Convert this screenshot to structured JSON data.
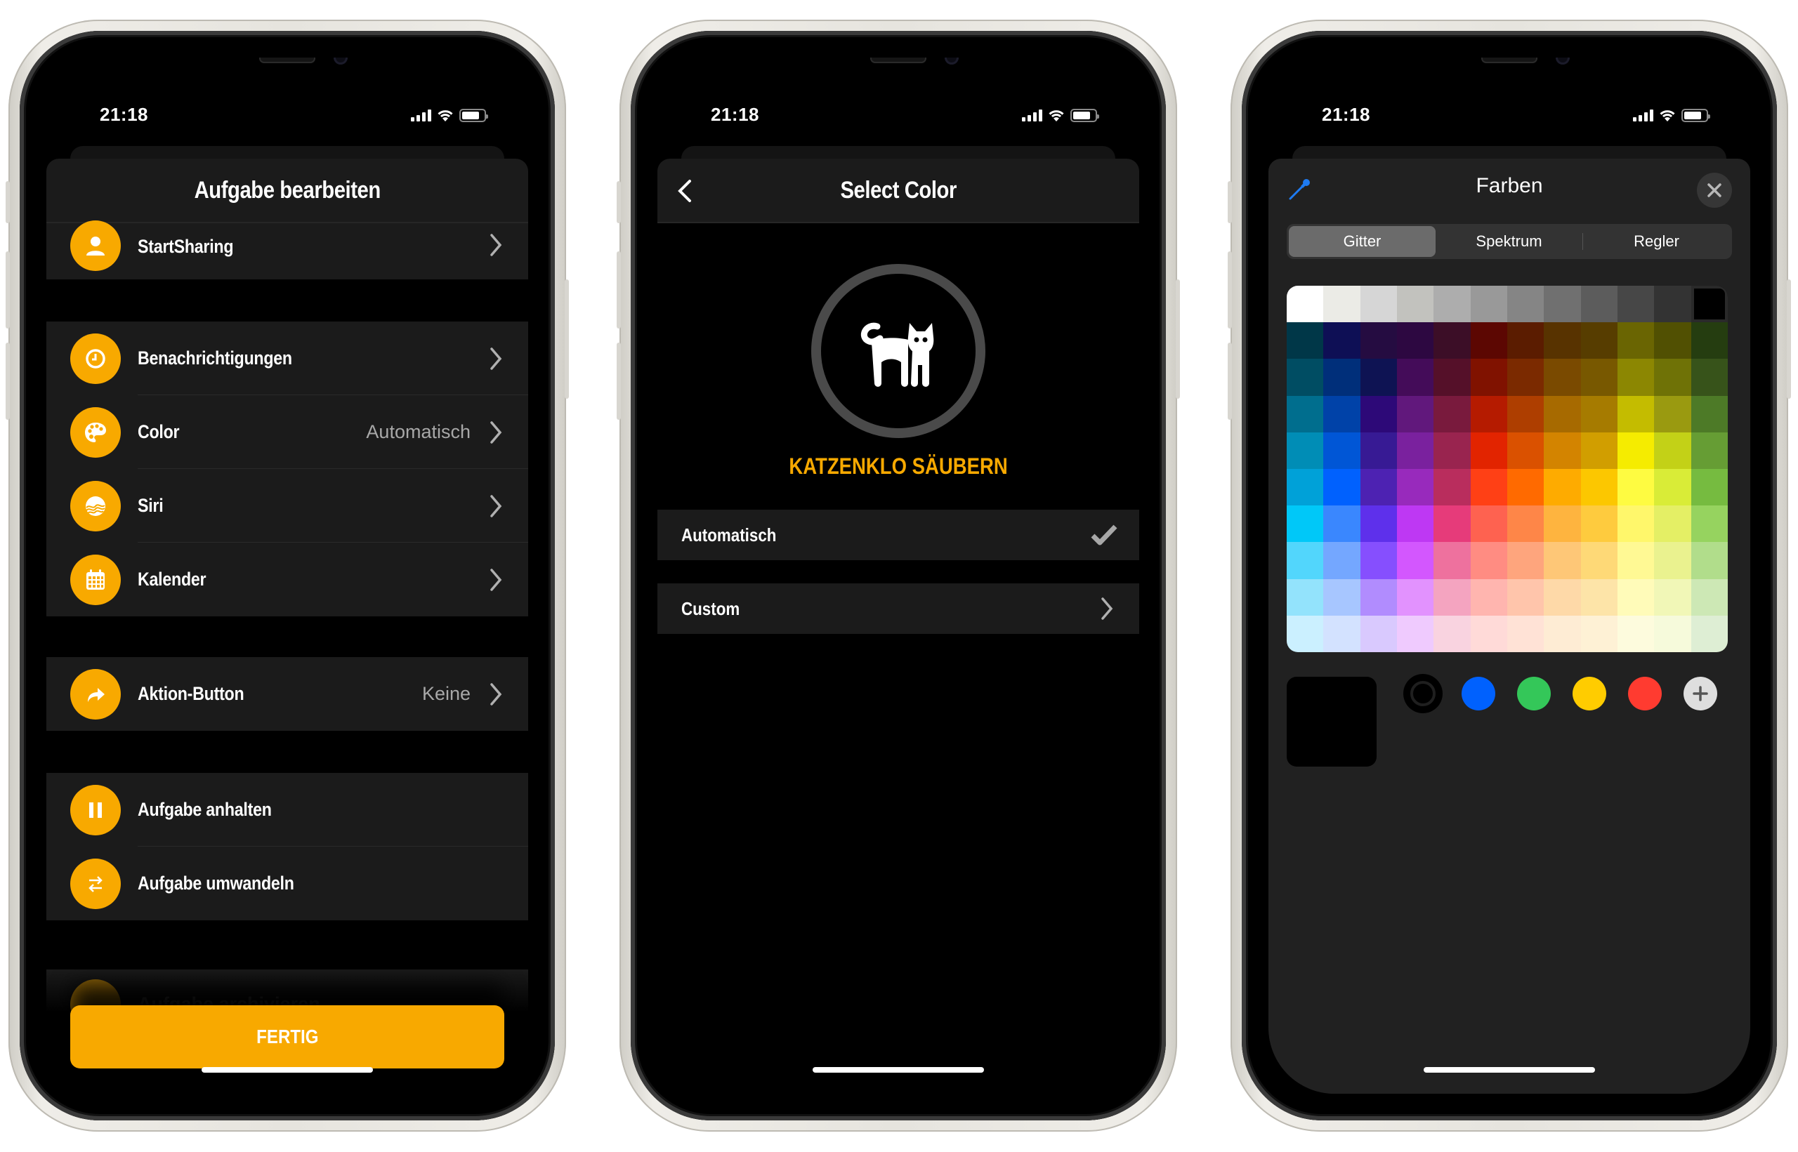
{
  "status_bar": {
    "time": "21:18"
  },
  "phone1": {
    "title": "Aufgabe bearbeiten",
    "groups": [
      [
        {
          "label": "StartSharing",
          "value": "",
          "icon": "person-icon"
        }
      ],
      [
        {
          "label": "Benachrichtigungen",
          "value": "",
          "icon": "clock-icon"
        },
        {
          "label": "Color",
          "value": "Automatisch",
          "icon": "palette-icon"
        },
        {
          "label": "Siri",
          "value": "",
          "icon": "siri-icon"
        },
        {
          "label": "Kalender",
          "value": "",
          "icon": "calendar-icon"
        }
      ],
      [
        {
          "label": "Aktion-Button",
          "value": "Keine",
          "icon": "action-arrow-icon"
        }
      ],
      [
        {
          "label": "Aufgabe anhalten",
          "value": "",
          "icon": "pause-icon"
        },
        {
          "label": "Aufgabe umwandeln",
          "value": "",
          "icon": "convert-icon"
        }
      ]
    ],
    "faded_row_label": "Aufgabe archivieren",
    "done_button": "FERTIG",
    "accent_color": "#F8A900"
  },
  "phone2": {
    "title": "Select Color",
    "task_name": "KATZENKLO SÄUBERN",
    "task_icon": "cat-icon",
    "options": [
      {
        "label": "Automatisch",
        "selected": true
      },
      {
        "label": "Custom",
        "selected": false
      }
    ]
  },
  "phone3": {
    "title": "Farben",
    "tabs": [
      {
        "label": "Gitter",
        "active": true
      },
      {
        "label": "Spektrum",
        "active": false
      },
      {
        "label": "Regler",
        "active": false
      }
    ],
    "grid_colors": [
      [
        "#FFFFFF",
        "#EBEBE6",
        "#D6D6D6",
        "#C2C2BE",
        "#ADADAD",
        "#999999",
        "#858585",
        "#707070",
        "#5C5C5C",
        "#474747",
        "#333333",
        "#000000"
      ],
      [
        "#003748",
        "#0E0F55",
        "#250C41",
        "#2D0841",
        "#3C0E27",
        "#5C0702",
        "#5B1C00",
        "#583300",
        "#573D00",
        "#6A6502",
        "#515002",
        "#253D10"
      ],
      [
        "#004D63",
        "#002F7A",
        "#0E1353",
        "#440C59",
        "#551029",
        "#801200",
        "#7B2A00",
        "#7A4A00",
        "#785800",
        "#8C8702",
        "#6F7206",
        "#37531A"
      ],
      [
        "#006E8E",
        "#0042A8",
        "#2D0978",
        "#61187C",
        "#791A3D",
        "#B51B00",
        "#AE3E00",
        "#A76A00",
        "#A67B00",
        "#C4BC00",
        "#9A9A10",
        "#4D7A27"
      ],
      [
        "#008DB6",
        "#0056D6",
        "#371A94",
        "#7A219E",
        "#99244F",
        "#E22400",
        "#DA5100",
        "#D38400",
        "#D19E00",
        "#F5EC00",
        "#C3D117",
        "#669D34"
      ],
      [
        "#00A1D8",
        "#0061FE",
        "#4D22B2",
        "#982ABC",
        "#B92D5D",
        "#FF4015",
        "#FF6A00",
        "#FEAB00",
        "#FCC700",
        "#FEFB41",
        "#D9EC37",
        "#76BB40"
      ],
      [
        "#00C8F8",
        "#3A87FE",
        "#5E30EB",
        "#BE38F3",
        "#E63B7A",
        "#FE6250",
        "#FE8648",
        "#FEB43F",
        "#FECB3E",
        "#FFF76B",
        "#E4EF65",
        "#96D35F"
      ],
      [
        "#52D6FC",
        "#74A7FF",
        "#864FFE",
        "#D357FE",
        "#EE719E",
        "#FF8C82",
        "#FEA57D",
        "#FEC777",
        "#FED977",
        "#FFF994",
        "#EAF28F",
        "#B1DD8B"
      ],
      [
        "#93E3FC",
        "#A7C6FF",
        "#B18CFE",
        "#E292FE",
        "#F4A4C0",
        "#FFB5AF",
        "#FFC5AB",
        "#FED9A8",
        "#FDE4A8",
        "#FFFBB9",
        "#F1F7B7",
        "#CDE8B5"
      ],
      [
        "#CBF0FF",
        "#D3E2FF",
        "#D9C9FE",
        "#EFCAFE",
        "#F9D3E0",
        "#FFDAD8",
        "#FFE2D6",
        "#FEECD4",
        "#FEF1D5",
        "#FDFBDD",
        "#F6FADB",
        "#DEEED4"
      ]
    ],
    "current_color": "#000000",
    "favorites": [
      {
        "color": "#000000",
        "selected": true
      },
      {
        "color": "#0061FE",
        "selected": false
      },
      {
        "color": "#34C759",
        "selected": false
      },
      {
        "color": "#FFCC00",
        "selected": false
      },
      {
        "color": "#FF3B30",
        "selected": false
      }
    ],
    "add_favorite_icon": "plus-icon"
  }
}
